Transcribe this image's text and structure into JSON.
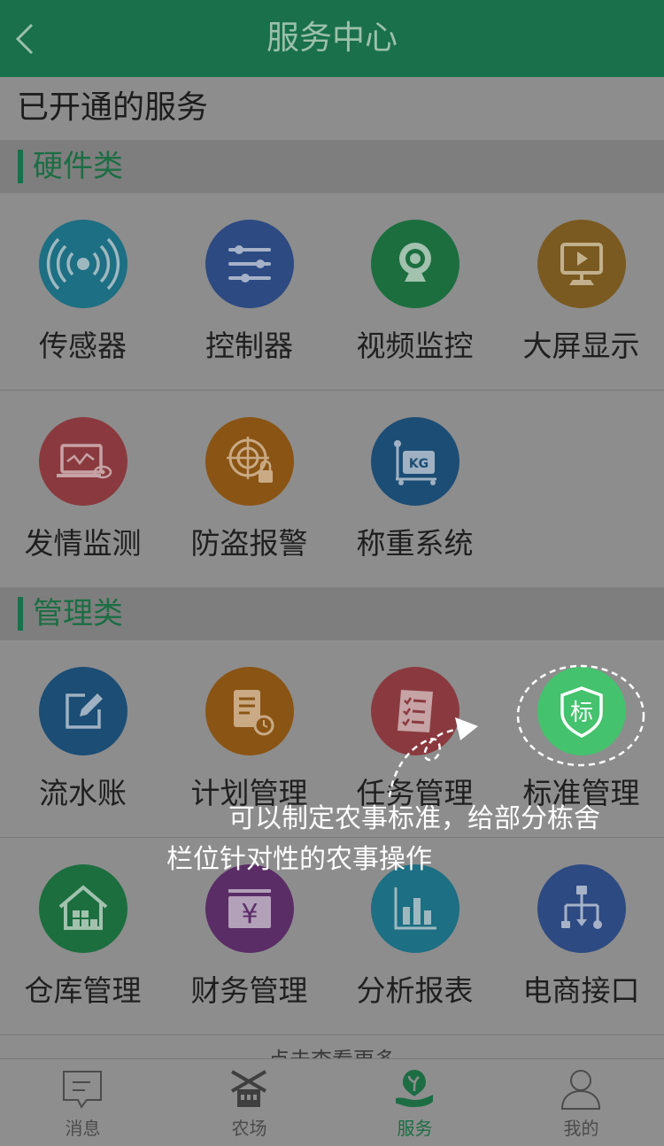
{
  "header": {
    "title": "服务中心"
  },
  "opened_title": "已开通的服务",
  "sections": [
    {
      "title": "硬件类",
      "items": [
        {
          "label": "传感器",
          "icon": "sensor-signal-icon",
          "color": "#1d6f83"
        },
        {
          "label": "控制器",
          "icon": "controller-sliders-icon",
          "color": "#2d4a82"
        },
        {
          "label": "视频监控",
          "icon": "camera-icon",
          "color": "#1c6e3f"
        },
        {
          "label": "大屏显示",
          "icon": "screen-display-icon",
          "color": "#7a5a20"
        },
        {
          "label": "发情监测",
          "icon": "estrus-monitor-icon",
          "color": "#8a3a3f"
        },
        {
          "label": "防盗报警",
          "icon": "anti-theft-alarm-icon",
          "color": "#8a5414"
        },
        {
          "label": "称重系统",
          "icon": "weighing-scale-icon",
          "color": "#1b4d75"
        }
      ]
    },
    {
      "title": "管理类",
      "items": [
        {
          "label": "流水账",
          "icon": "edit-ledger-icon",
          "color": "#1b4d75"
        },
        {
          "label": "计划管理",
          "icon": "plan-clock-icon",
          "color": "#8a5414"
        },
        {
          "label": "任务管理",
          "icon": "task-checklist-icon",
          "color": "#8a3a3f"
        },
        {
          "label": "标准管理",
          "icon": "standard-shield-icon",
          "color": "#44c26d",
          "icon_text": "标"
        },
        {
          "label": "仓库管理",
          "icon": "warehouse-icon",
          "color": "#1c6e3f"
        },
        {
          "label": "财务管理",
          "icon": "finance-yen-icon",
          "color": "#5a2d66"
        },
        {
          "label": "分析报表",
          "icon": "analysis-chart-icon",
          "color": "#1d6f83"
        },
        {
          "label": "电商接口",
          "icon": "ecommerce-interface-icon",
          "color": "#2d4a82"
        }
      ]
    }
  ],
  "more_text": "点击查看更多",
  "annotation": {
    "line1": "可以制定农事标准，给部分栋舍",
    "line2": "栏位针对性的农事操作"
  },
  "tabs": [
    {
      "label": "消息",
      "icon": "message-icon",
      "active": false
    },
    {
      "label": "农场",
      "icon": "farm-icon",
      "active": false
    },
    {
      "label": "服务",
      "icon": "service-plant-hand-icon",
      "active": true
    },
    {
      "label": "我的",
      "icon": "user-profile-icon",
      "active": false
    }
  ],
  "colors": {
    "header": "#19704b",
    "accent": "#1c6d44",
    "overlay_bg": "#8d8d8d"
  }
}
